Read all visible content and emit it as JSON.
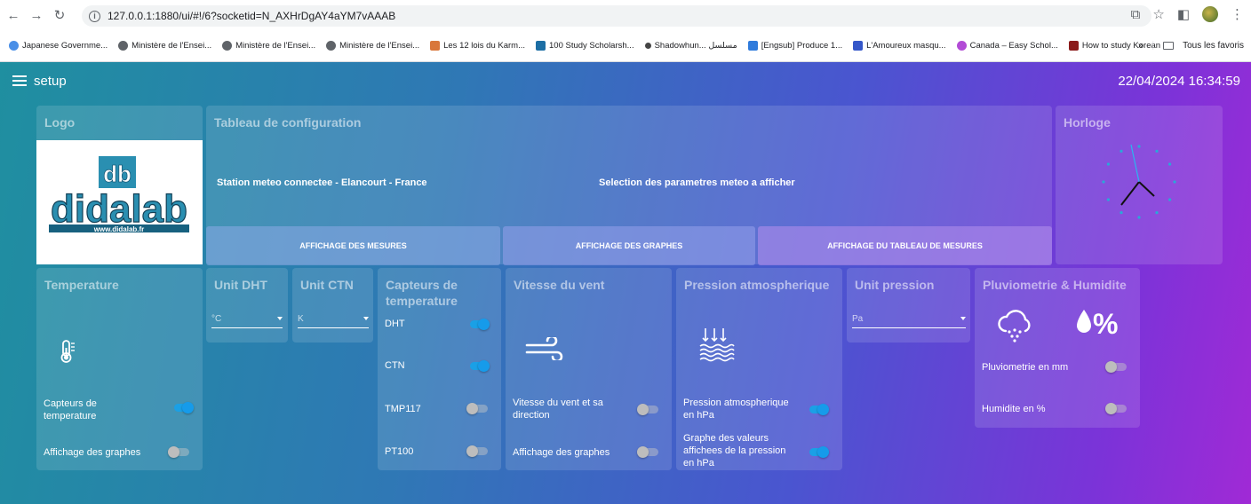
{
  "browser": {
    "url": "127.0.0.1:1880/ui/#!/6?socketid=N_AXHrDgAY4aYM7vAAAB",
    "bookmarks": [
      "Japanese Governme...",
      "Ministère de l'Ensei...",
      "Ministère de l'Ensei...",
      "Ministère de l'Ensei...",
      "Les 12 lois du Karm...",
      "100 Study Scholarsh...",
      "Shadowhun... مسلسل",
      "[Engsub] Produce 1...",
      "L'Amoureux masqu...",
      "Canada – Easy Schol...",
      "How to study Korean"
    ],
    "more": "»",
    "all_favorites": "Tous les favoris"
  },
  "header": {
    "title": "setup",
    "datetime": "22/04/2024 16:34:59"
  },
  "logo": {
    "title": "Logo",
    "brand_top": "db",
    "brand": "didalab",
    "url": "www.didalab.fr"
  },
  "config": {
    "title": "Tableau de configuration",
    "station": "Station meteo connectee - Elancourt - France",
    "selection": "Selection des parametres meteo a afficher",
    "buttons": [
      "AFFICHAGE DES MESURES",
      "AFFICHAGE DES GRAPHES",
      "AFFICHAGE DU TABLEAU DE MESURES"
    ]
  },
  "clock": {
    "title": "Horloge"
  },
  "temperature": {
    "title": "Temperature",
    "sensors_label": "Capteurs de temperature",
    "sensors_on": true,
    "graphs_label": "Affichage des graphes",
    "graphs_on": false
  },
  "unit_dht": {
    "title": "Unit DHT",
    "value": "°C"
  },
  "unit_ctn": {
    "title": "Unit CTN",
    "value": "K"
  },
  "sensors": {
    "title": "Capteurs de temperature",
    "items": [
      {
        "label": "DHT",
        "on": true
      },
      {
        "label": "CTN",
        "on": true
      },
      {
        "label": "TMP117",
        "on": false
      },
      {
        "label": "PT100",
        "on": false
      }
    ]
  },
  "wind": {
    "title": "Vitesse du vent",
    "speed_label": "Vitesse du vent et sa direction",
    "speed_on": false,
    "graphs_label": "Affichage des graphes",
    "graphs_on": false
  },
  "pressure": {
    "title": "Pression atmospherique",
    "hpa_label": "Pression atmospherique en hPa",
    "hpa_on": true,
    "graph_label": "Graphe des valeurs affichees de la pression en hPa",
    "graph_on": true
  },
  "unit_pressure": {
    "title": "Unit pression",
    "value": "Pa"
  },
  "rain": {
    "title": "Pluviometrie & Humidite",
    "rain_label": "Pluviometrie en mm",
    "rain_on": false,
    "humidity_label": "Humidite en %",
    "humidity_on": false
  },
  "colors": {
    "toggle_on": "#169bea",
    "toggle_off": "#bdbdbd"
  }
}
